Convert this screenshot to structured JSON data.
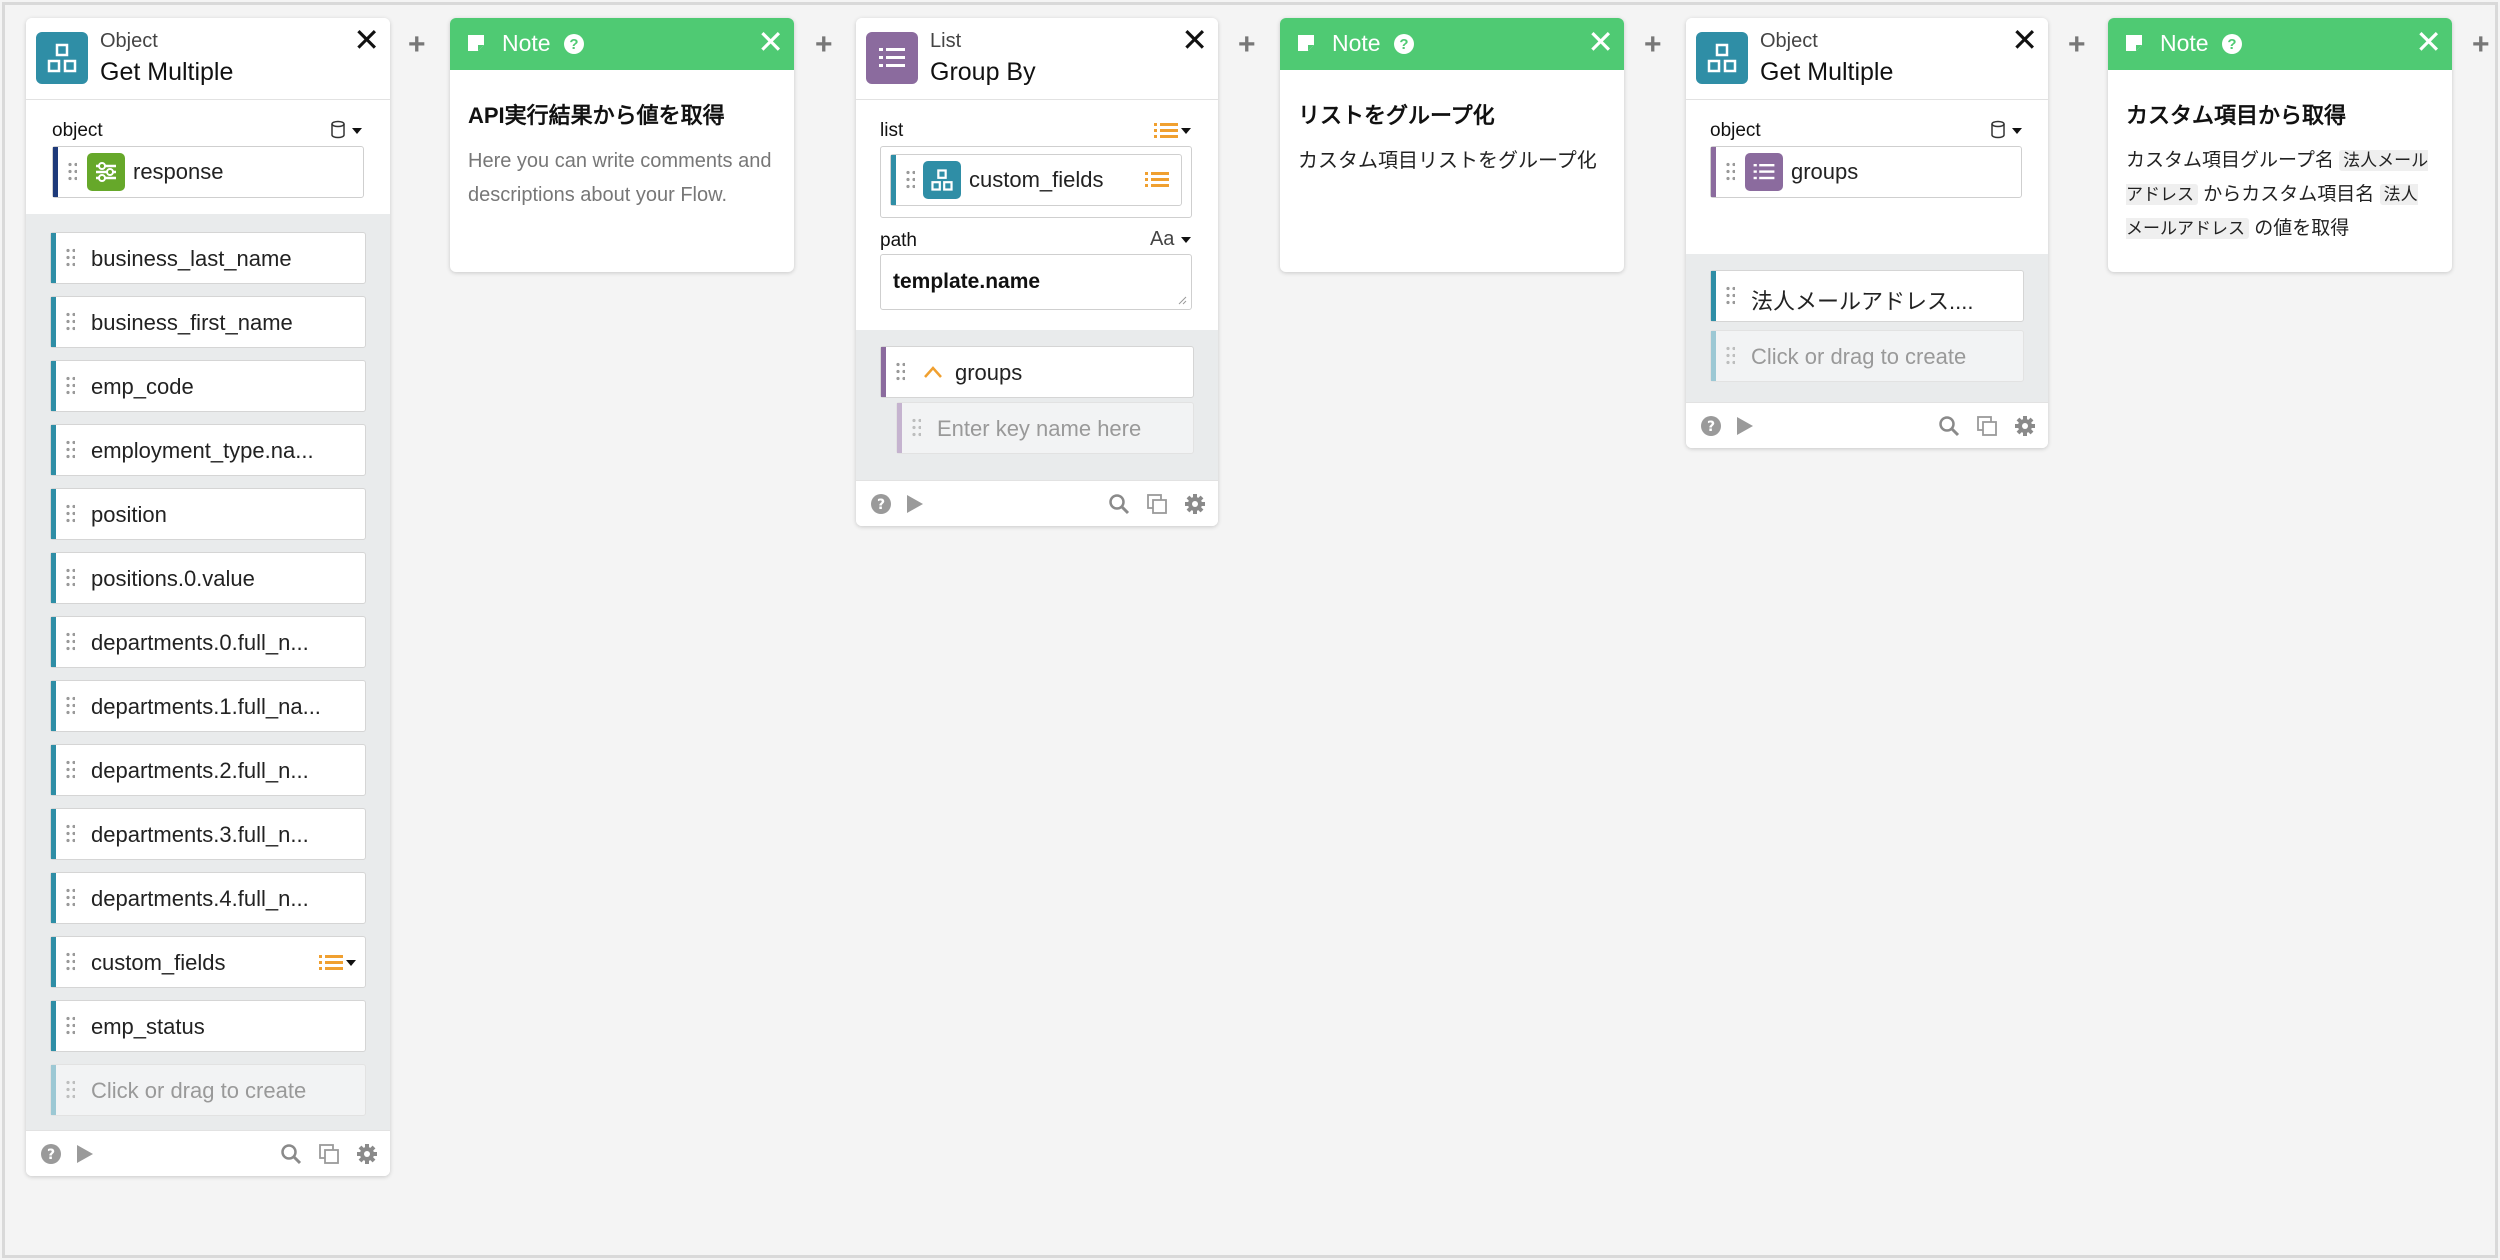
{
  "colors": {
    "teal": "#2f8ea6",
    "purple": "#8b6b9e",
    "note_green": "#4fca73",
    "navy": "#1e3a7a",
    "response_green": "#66a82a",
    "orange": "#f0a030"
  },
  "card1": {
    "category": "Object",
    "title": "Get Multiple",
    "object_label": "object",
    "object_value": "response",
    "keys": [
      "business_last_name",
      "business_first_name",
      "emp_code",
      "employment_type.na...",
      "position",
      "positions.0.value",
      "departments.0.full_n...",
      "departments.1.full_na...",
      "departments.2.full_n...",
      "departments.3.full_n...",
      "departments.4.full_n...",
      "custom_fields",
      "emp_status"
    ],
    "create_placeholder": "Click or drag to create"
  },
  "note1": {
    "label": "Note",
    "title": "API実行結果から値を取得",
    "text": "Here you can write comments and descriptions about your Flow."
  },
  "card2": {
    "category": "List",
    "title": "Group By",
    "list_label": "list",
    "list_value": "custom_fields",
    "path_label": "path",
    "path_type": "Aa",
    "path_value": "template.name",
    "output_key": "groups",
    "key_placeholder": "Enter key name here"
  },
  "note2": {
    "label": "Note",
    "title": "リストをグループ化",
    "text": "カスタム項目リストをグループ化"
  },
  "card3": {
    "category": "Object",
    "title": "Get Multiple",
    "object_label": "object",
    "object_value": "groups",
    "key": "法人メールアドレス....",
    "create_placeholder": "Click or drag to create"
  },
  "note3": {
    "label": "Note",
    "title": "カスタム項目から取得",
    "text_a": "カスタム項目グループ名",
    "chip_a": "法人メールアドレス",
    "text_b": "からカスタム項目名",
    "chip_b": "法人メールアドレス",
    "text_c": "の値を取得"
  },
  "close_glyph": "✕",
  "plus_glyph": "+",
  "help_glyph": "?"
}
